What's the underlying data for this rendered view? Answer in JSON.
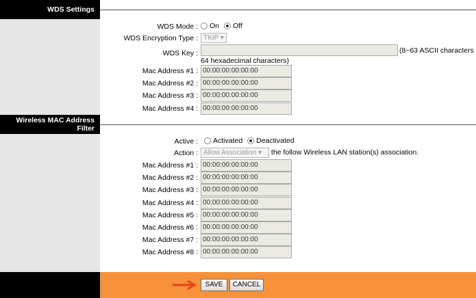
{
  "wds": {
    "section_title": "WDS Settings",
    "mode_label": "WDS Mode :",
    "mode_on": "On",
    "mode_off": "Off",
    "mode_selected": "Off",
    "encryption_label": "WDS Encryption Type :",
    "encryption_value": "TKIP",
    "key_label": "WDS Key :",
    "key_value": "",
    "key_hint_1": "(8~63 ASCII characters or",
    "key_hint_2": "64 hexadecimal characters)",
    "mac_rows": [
      {
        "label": "Mac Address #1 :",
        "value": "00:00:00:00:00:00"
      },
      {
        "label": "Mac Address #2 :",
        "value": "00:00:00:00:00:00"
      },
      {
        "label": "Mac Address #3 :",
        "value": "00:00:00:00:00:00"
      },
      {
        "label": "Mac Address #4 :",
        "value": "00:00:00:00:00:00"
      }
    ]
  },
  "filter": {
    "section_title_1": "Wireless MAC Address",
    "section_title_2": "Filter",
    "active_label": "Active :",
    "active_activated": "Activated",
    "active_deactivated": "Deactivated",
    "active_selected": "Deactivated",
    "action_label": "Action :",
    "action_value": "Allow Association",
    "action_suffix": "the follow Wireless LAN station(s) association.",
    "mac_rows": [
      {
        "label": "Mac Address #1 :",
        "value": "00:00:00:00:00:00"
      },
      {
        "label": "Mac Address #2 :",
        "value": "00:00:00:00:00:00"
      },
      {
        "label": "Mac Address #3 :",
        "value": "00:00:00:00:00:00"
      },
      {
        "label": "Mac Address #4 :",
        "value": "00:00:00:00:00:00"
      },
      {
        "label": "Mac Address #5 :",
        "value": "00:00:00:00:00:00"
      },
      {
        "label": "Mac Address #6 :",
        "value": "00:00:00:00:00:00"
      },
      {
        "label": "Mac Address #7 :",
        "value": "00:00:00:00:00:00"
      },
      {
        "label": "Mac Address #8 :",
        "value": "00:00:00:00:00:00"
      }
    ]
  },
  "footer": {
    "save_label": "SAVE",
    "cancel_label": "CANCEL",
    "accent_color": "#f7923a",
    "arrow_color": "#e8421b"
  }
}
